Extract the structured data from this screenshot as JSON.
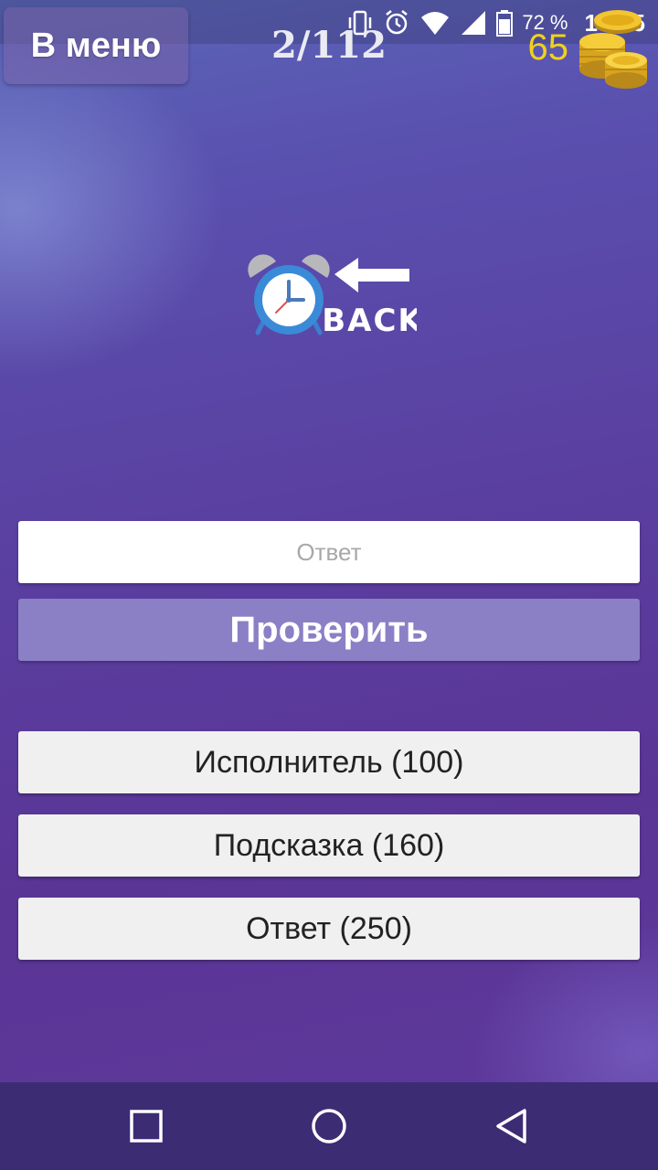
{
  "status_bar": {
    "battery": "72 %",
    "time": "14:45",
    "icons": [
      "vibrate-icon",
      "alarm-icon",
      "wifi-icon",
      "signal-icon",
      "battery-icon"
    ]
  },
  "header": {
    "menu_label": "В меню",
    "progress": "2/112",
    "coins": "65"
  },
  "question": {
    "image_text": "BACK"
  },
  "answer": {
    "placeholder": "Ответ",
    "check_label": "Проверить"
  },
  "hints": [
    {
      "label": "Исполнитель (100)"
    },
    {
      "label": "Подсказка (160)"
    },
    {
      "label": "Ответ (250)"
    }
  ],
  "colors": {
    "coins": "#f1d21a",
    "check_button": "#8b80c6",
    "navbar": "#3c2c74"
  }
}
